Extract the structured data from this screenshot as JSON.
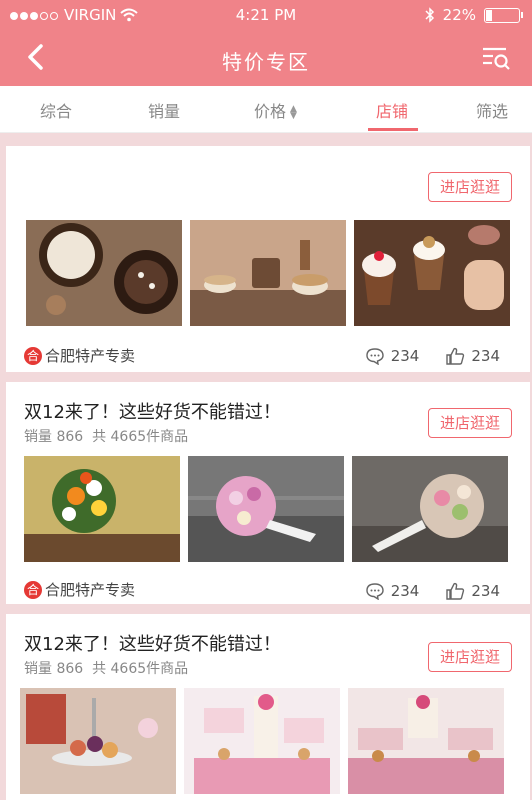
{
  "status": {
    "carrier": "VIRGIN",
    "time": "4:21 PM",
    "battery": "22%"
  },
  "header": {
    "title": "特价专区"
  },
  "tabs": [
    {
      "label": "综合"
    },
    {
      "label": "销量"
    },
    {
      "label": "价格"
    },
    {
      "label": "店铺"
    },
    {
      "label": "筛选"
    }
  ],
  "cards": [
    {
      "title": "",
      "sales_label": "",
      "button": "进店逛逛",
      "shop_badge": "合",
      "shop_name": "合肥特产专卖",
      "comments": "234",
      "likes": "234"
    },
    {
      "title": "双12来了！这些好货不能错过！",
      "sales_label": "销量 866",
      "total_label": "共 4665件商品",
      "button": "进店逛逛",
      "shop_badge": "合",
      "shop_name": "合肥特产专卖",
      "comments": "234",
      "likes": "234"
    },
    {
      "title": "双12来了！这些好货不能错过！",
      "sales_label": "销量 866",
      "total_label": "共 4665件商品",
      "button": "进店逛逛"
    }
  ]
}
